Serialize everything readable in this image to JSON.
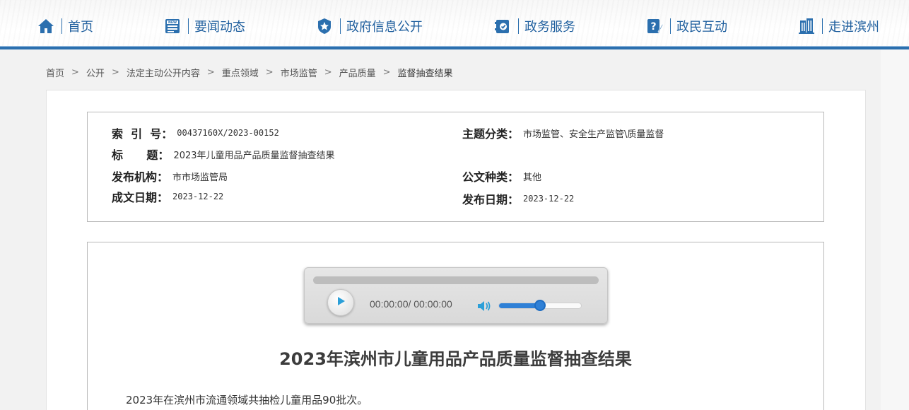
{
  "nav": {
    "items": [
      {
        "label": "首页",
        "icon": "home-icon"
      },
      {
        "label": "要闻动态",
        "icon": "news-icon"
      },
      {
        "label": "政府信息公开",
        "icon": "badge-star-icon"
      },
      {
        "label": "政务服务",
        "icon": "service-icon"
      },
      {
        "label": "政民互动",
        "icon": "question-pen-icon"
      },
      {
        "label": "走进滨州",
        "icon": "building-icon"
      }
    ],
    "accent_color": "#2b6fae"
  },
  "breadcrumb": [
    "首页",
    "公开",
    "法定主动公开内容",
    "重点领域",
    "市场监管",
    "产品质量",
    "监督抽查结果"
  ],
  "breadcrumb_sep": ">",
  "meta": {
    "index_label": "索  引  号：",
    "index_value": "00437160X/2023-00152",
    "subject_label": "主题分类：",
    "subject_value": "市场监管、安全生产监管\\质量监督",
    "title_label": "标      题：",
    "title_value": "2023年儿童用品产品质量监督抽查结果",
    "publisher_label": "发布机构：",
    "publisher_value": "市市场监管局",
    "doctype_label": "公文种类：",
    "doctype_value": "其他",
    "created_label": "成文日期：",
    "created_value": "2023-12-22",
    "published_label": "发布日期：",
    "published_value": "2023-12-22"
  },
  "player": {
    "time_display": "00:00:00/ 00:00:00",
    "volume_level": 0.5,
    "play_icon": "play-icon",
    "volume_icon": "speaker-icon"
  },
  "article": {
    "title": "2023年滨州市儿童用品产品质量监督抽查结果",
    "paragraph": "2023年在滨州市流通领域共抽检儿童用品90批次。"
  }
}
